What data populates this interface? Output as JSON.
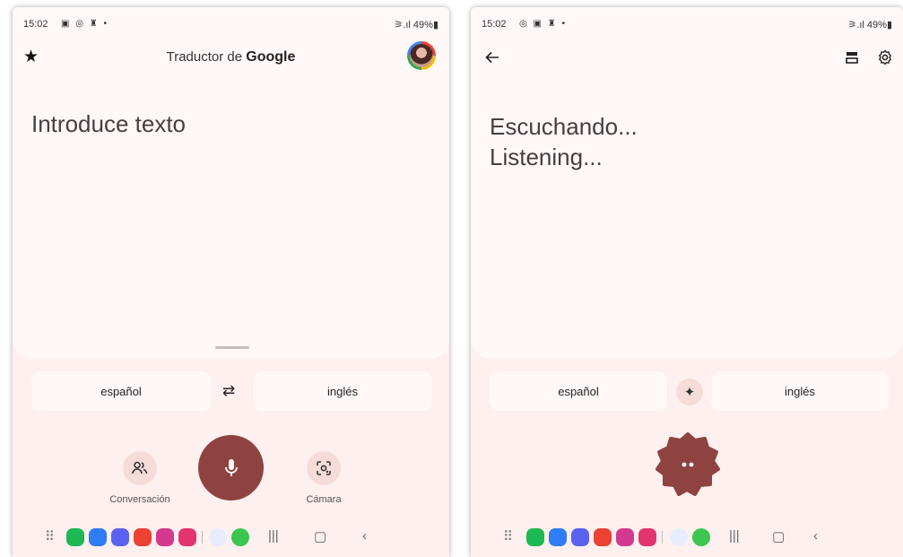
{
  "left": {
    "status": {
      "time": "15:02",
      "icons": "▣ ◎ ♜ •",
      "right": "⚞.ıl 49%▮"
    },
    "appbar": {
      "title_prefix": "Traductor de ",
      "title_brand": "Google"
    },
    "input": {
      "placeholder": "Introduce texto"
    },
    "languages": {
      "source": "español",
      "target": "inglés"
    },
    "actions": {
      "conversation_label": "Conversación",
      "camera_label": "Cámara"
    }
  },
  "right": {
    "status": {
      "time": "15:02",
      "icons": "◎ ▣ ♜ •",
      "right": "⚞.ıl 49%▮"
    },
    "listening": {
      "line1": "Escuchando...",
      "line2": "Listening..."
    },
    "languages": {
      "source": "español",
      "target": "inglés"
    }
  },
  "colors": {
    "accent": "#8f4340",
    "sheet": "#fff8f7",
    "background": "#fdf0ef",
    "chip": "#f6dcd8"
  },
  "dock_apps": [
    "phone-app",
    "messages-app",
    "internet-app",
    "flipboard-app",
    "gallery-app",
    "camera-app",
    "ai-app",
    "whatsapp-app"
  ],
  "dock_colors": [
    "#1db954",
    "#2f7df6",
    "#5b62f2",
    "#ec4133",
    "#d33a8f",
    "#e33470",
    "#e8ecff",
    "#3ac64f"
  ]
}
